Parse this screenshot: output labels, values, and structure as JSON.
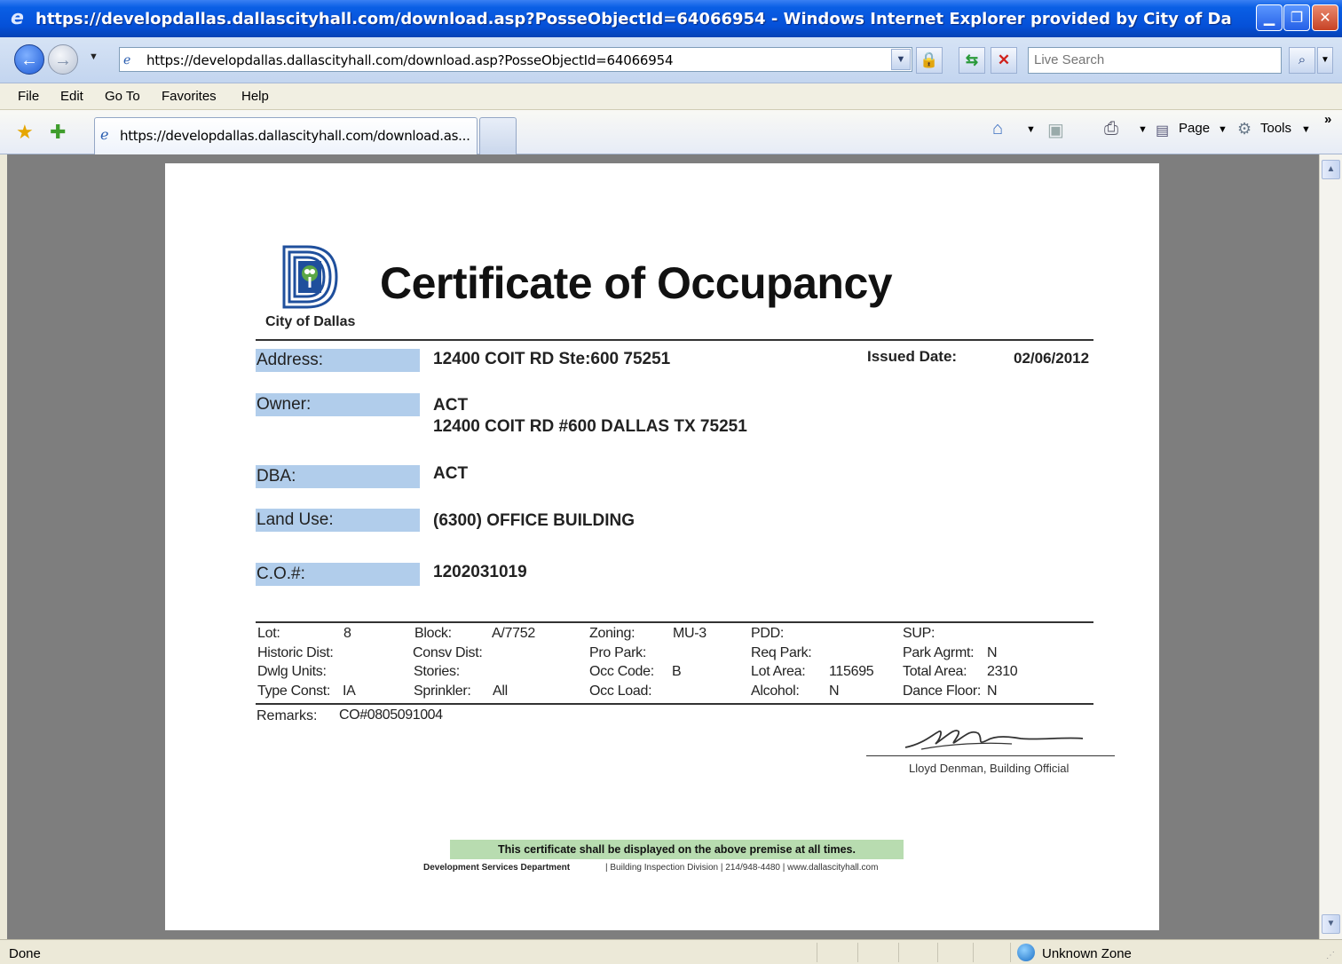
{
  "window": {
    "title": "https://developdallas.dallascityhall.com/download.asp?PosseObjectId=64066954 - Windows Internet Explorer provided by City of Da"
  },
  "address_bar": {
    "url": "https://developdallas.dallascityhall.com/download.asp?PosseObjectId=64066954",
    "search_placeholder": "Live Search"
  },
  "menu": {
    "items": [
      "File",
      "Edit",
      "Go To",
      "Favorites",
      "Help"
    ]
  },
  "tabs": {
    "active_label": "https://developdallas.dallascityhall.com/download.as..."
  },
  "command_bar": {
    "page_label": "Page",
    "tools_label": "Tools",
    "chevron": "»"
  },
  "certificate": {
    "city_name": "City of Dallas",
    "title": "Certificate of Occupancy",
    "address_label": "Address:",
    "address_value": "12400 COIT RD Ste:600 75251",
    "issued_label": "Issued Date:",
    "issued_value": "02/06/2012",
    "owner_label": "Owner:",
    "owner_name": "ACT",
    "owner_address": "12400 COIT RD #600 DALLAS TX 75251",
    "dba_label": "DBA:",
    "dba_value": "ACT",
    "land_use_label": "Land Use:",
    "land_use_value": "(6300) OFFICE BUILDING",
    "co_label": "C.O.#:",
    "co_value": "1202031019",
    "grid": {
      "lot_label": "Lot:",
      "lot_value": "8",
      "historic_label": "Historic Dist:",
      "dwlg_label": "Dwlg Units:",
      "type_const_label": "Type Const:",
      "type_const_value": "IA",
      "block_label": "Block:",
      "block_value": "A/7752",
      "consv_label": "Consv Dist:",
      "stories_label": "Stories:",
      "sprinkler_label": "Sprinkler:",
      "sprinkler_value": "All",
      "zoning_label": "Zoning:",
      "zoning_value": "MU-3",
      "pro_park_label": "Pro Park:",
      "occ_code_label": "Occ Code:",
      "occ_code_value": "B",
      "occ_load_label": "Occ Load:",
      "pdd_label": "PDD:",
      "req_park_label": "Req Park:",
      "lot_area_label": "Lot Area:",
      "lot_area_value": "115695",
      "alcohol_label": "Alcohol:",
      "alcohol_value": "N",
      "sup_label": "SUP:",
      "park_agrmt_label": "Park Agrmt:",
      "park_agrmt_value": "N",
      "total_area_label": "Total Area:",
      "total_area_value": "2310",
      "dance_floor_label": "Dance Floor:",
      "dance_floor_value": "N"
    },
    "remarks_label": "Remarks:",
    "remarks_value": "CO#0805091004",
    "signature_name": "Lloyd Denman, Building Official",
    "notice": "This certificate shall be displayed on the above premise at all times.",
    "dept": "Development Services Department",
    "dept_info": "| Building Inspection Division | 214/948-4480 | www.dallascityhall.com"
  },
  "status_bar": {
    "status": "Done",
    "zone": "Unknown Zone"
  },
  "colors": {
    "label_bg": "#b1cdeb",
    "notice_bg": "#b8dcb0",
    "logo_blue": "#1f4f9c",
    "logo_green": "#5aa646"
  },
  "icons": [
    "ie-logo-icon",
    "minimize-icon",
    "maximize-icon",
    "close-icon",
    "back-arrow-icon",
    "forward-arrow-icon",
    "page-icon",
    "lock-icon",
    "refresh-icon",
    "stop-icon",
    "search-icon",
    "favorites-star-icon",
    "add-favorites-icon",
    "home-icon",
    "feeds-icon",
    "print-icon",
    "page-menu-icon",
    "tools-gear-icon",
    "globe-icon"
  ]
}
